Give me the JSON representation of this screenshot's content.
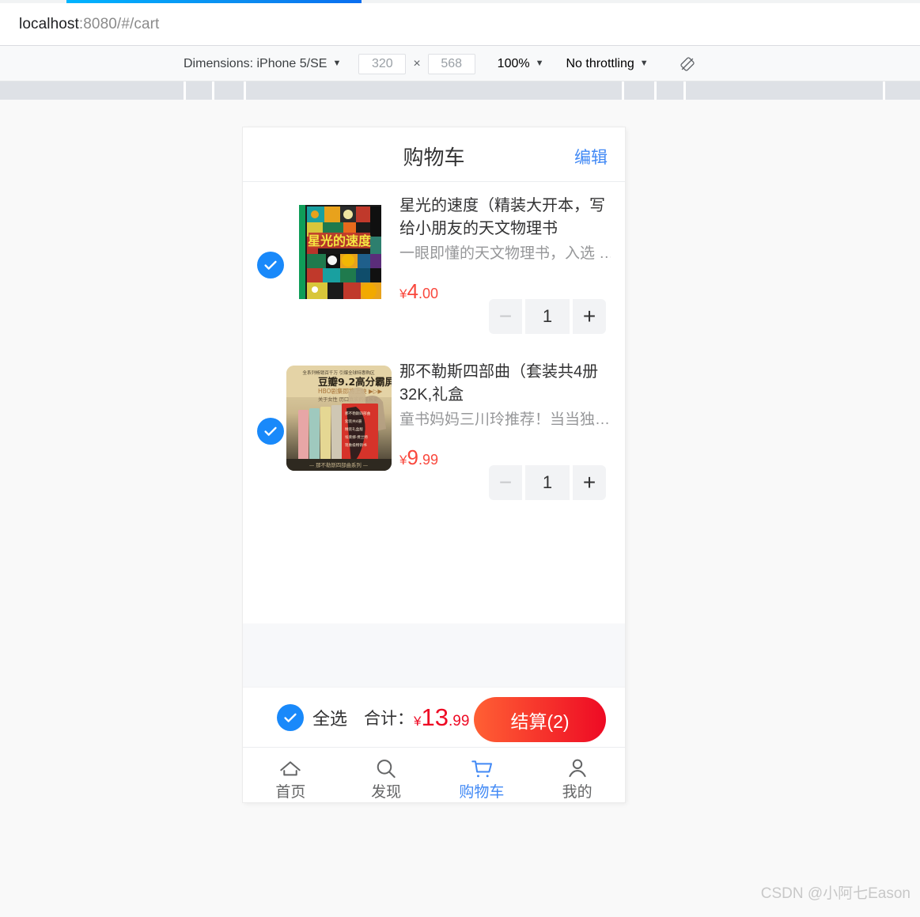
{
  "browser": {
    "url_host": "localhost",
    "url_path": ":8080/#/cart"
  },
  "device_toolbar": {
    "dimensions_label": "Dimensions: iPhone 5/SE",
    "width_value": "320",
    "times_symbol": "×",
    "height_value": "568",
    "zoom_label": "100%",
    "throttling_label": "No throttling",
    "rotate_icon": "rotate-icon",
    "caret": "▼"
  },
  "app": {
    "navbar": {
      "title": "购物车",
      "action": "编辑"
    },
    "cart_items": [
      {
        "checked": true,
        "title": "星光的速度（精装大开本，写给小朋友的天文物理书",
        "desc": "一眼即懂的天文物理书，入选 …",
        "price_symbol": "¥",
        "price_int": "4",
        "price_dec": ".00",
        "qty": "1",
        "minus_label": "−",
        "plus_label": "+",
        "thumb": "book-cover-starlight"
      },
      {
        "checked": true,
        "title": "那不勒斯四部曲（套装共4册 32K,礼盒",
        "desc": "童书妈妈三川玲推荐！当当独…",
        "price_symbol": "¥",
        "price_int": "9",
        "price_dec": ".99",
        "qty": "1",
        "minus_label": "−",
        "plus_label": "+",
        "thumb": "book-cover-naples"
      }
    ],
    "submit_bar": {
      "select_all_label": "全选",
      "total_label": "合计：",
      "total_symbol": "¥",
      "total_int": "13",
      "total_dec": ".99",
      "checkout_label": "结算(2)"
    },
    "tabbar": [
      {
        "label": "首页",
        "icon": "home-icon",
        "active": false
      },
      {
        "label": "发现",
        "icon": "search-icon",
        "active": false
      },
      {
        "label": "购物车",
        "icon": "cart-icon",
        "active": true
      },
      {
        "label": "我的",
        "icon": "user-icon",
        "active": false
      }
    ]
  },
  "watermark": "CSDN @小阿七Eason",
  "colors": {
    "accent_blue": "#1989fa",
    "link_blue": "#4189f5",
    "price_red": "#ee0a24",
    "checkout_gradient_start": "#ff6034",
    "checkout_gradient_end": "#ee0a24",
    "page_bg": "#f7f8fa"
  }
}
